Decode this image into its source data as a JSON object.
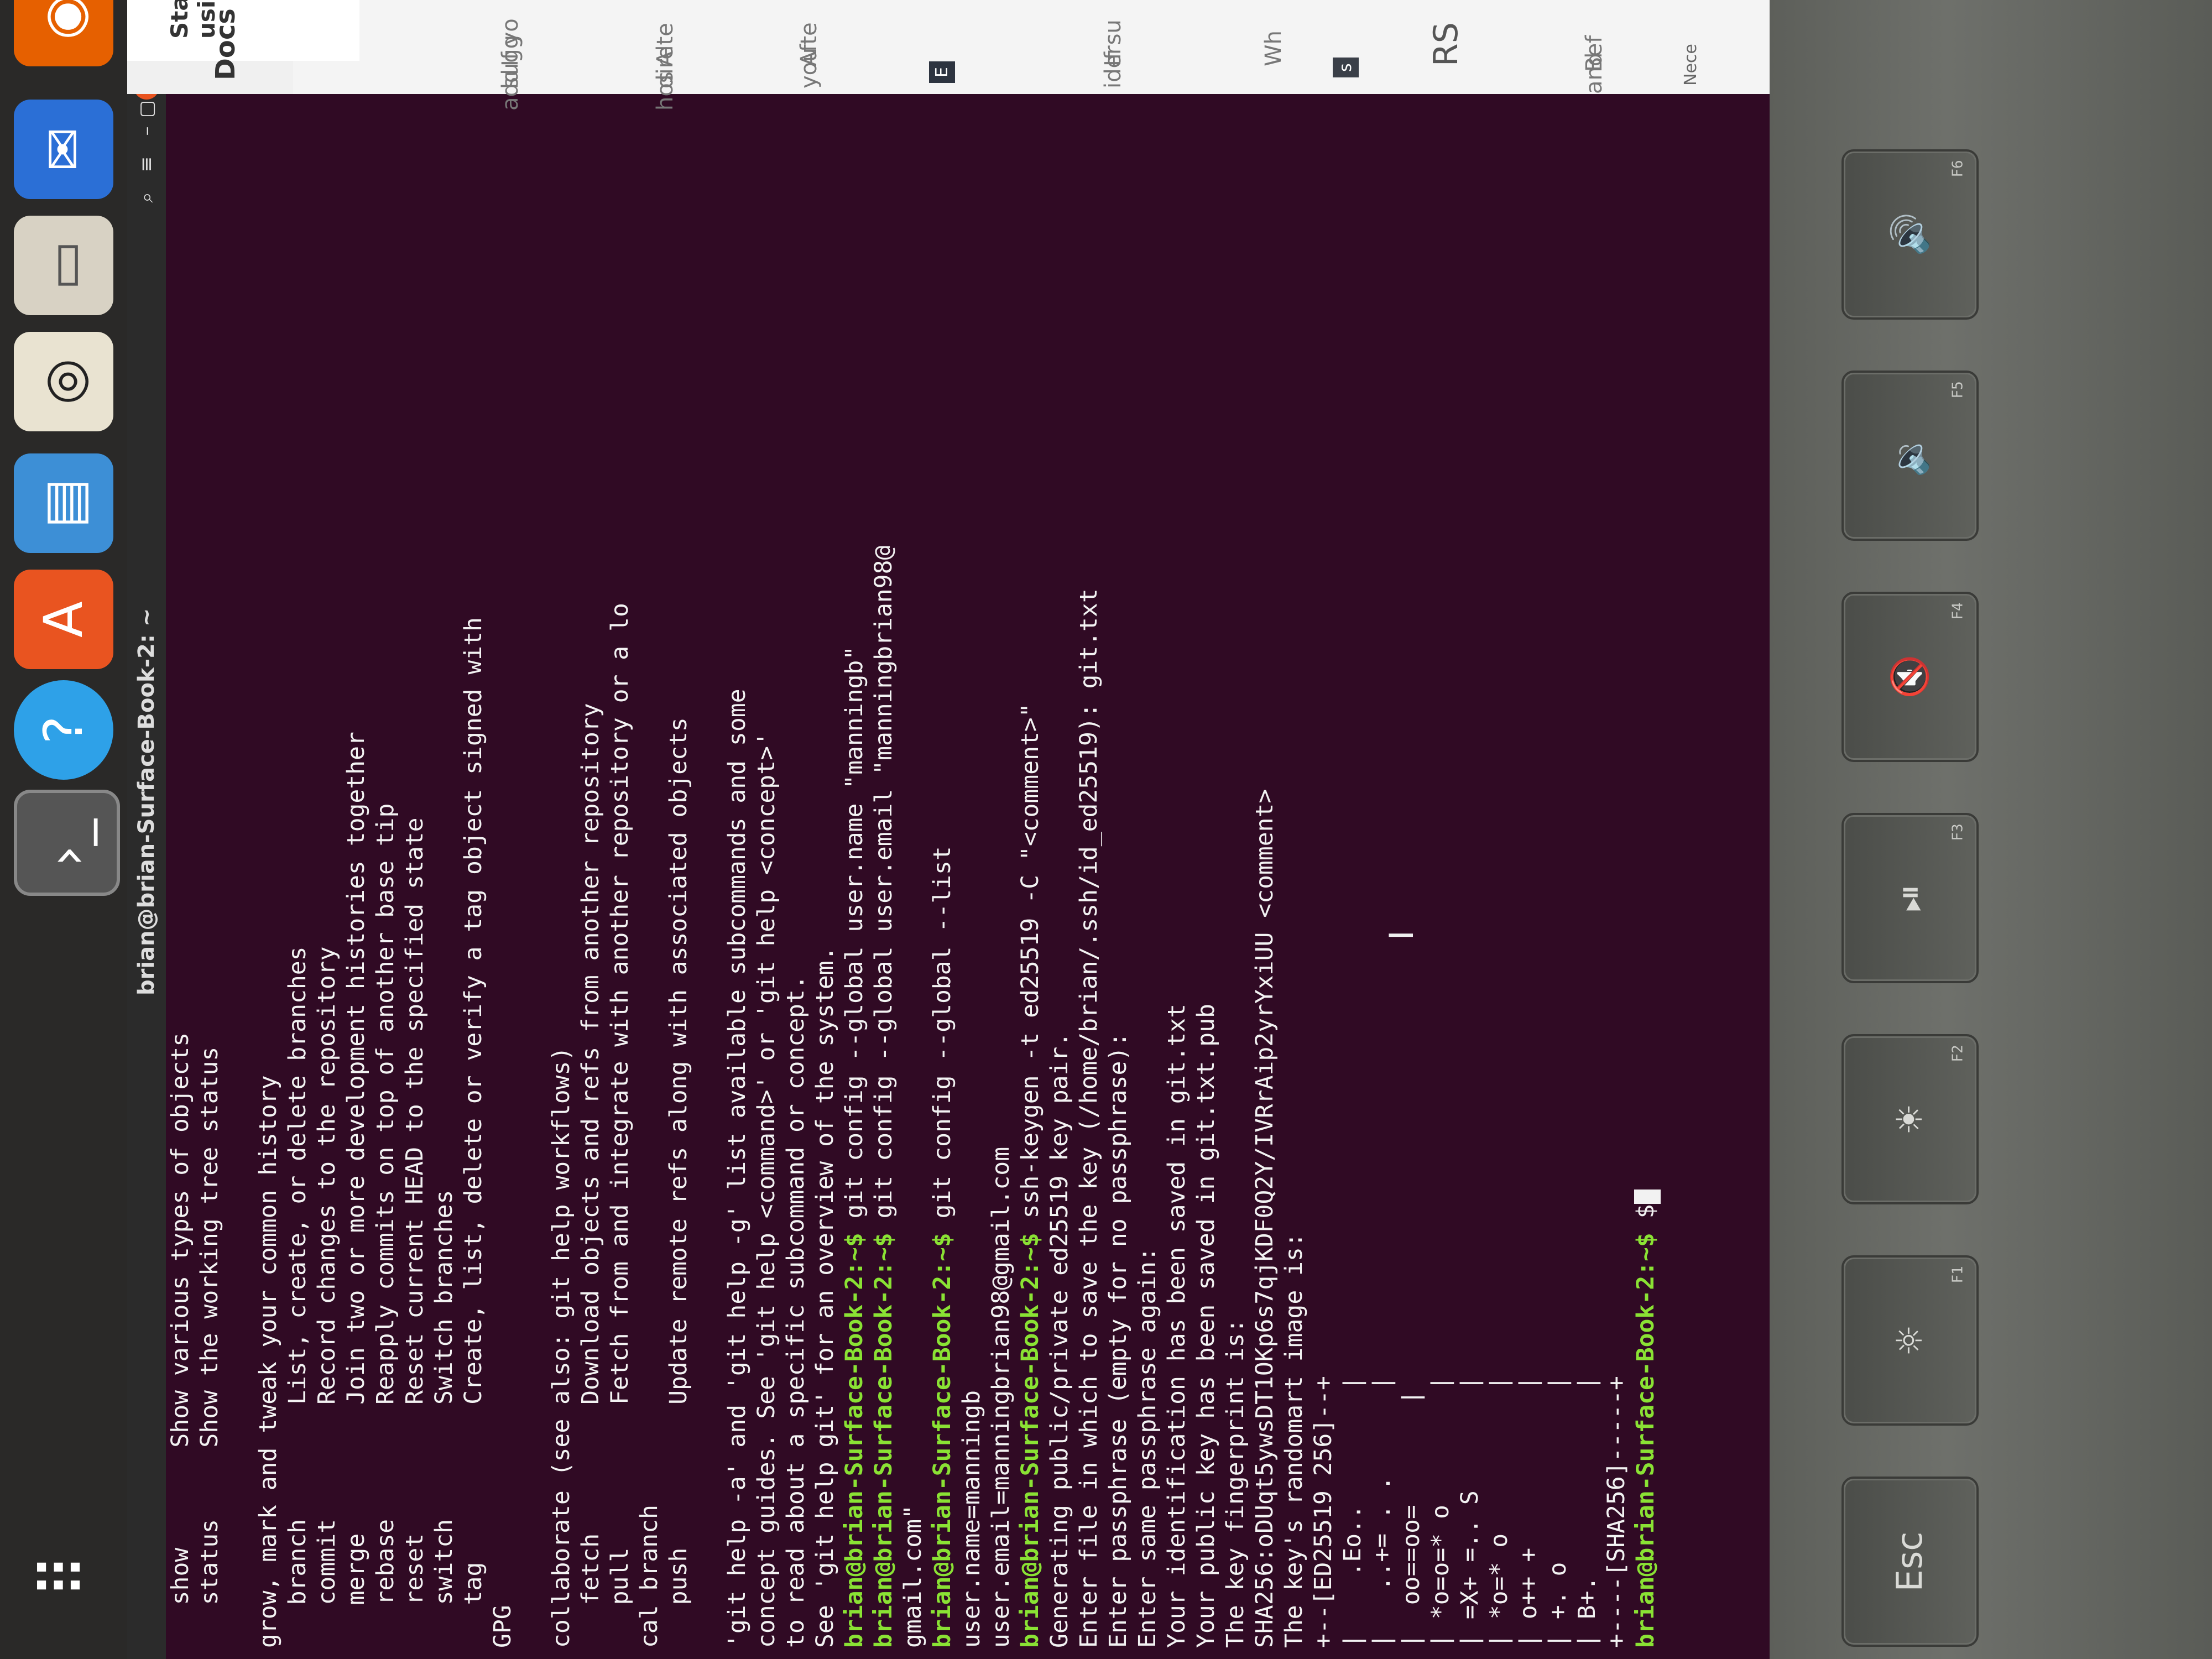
{
  "terminal": {
    "title": "brian@brian-Surface-Book-2: ~",
    "lines": [
      {
        "type": "text",
        "text": "   show       Show various types of objects"
      },
      {
        "type": "text",
        "text": "   status     Show the working tree status"
      },
      {
        "type": "text",
        "text": ""
      },
      {
        "type": "text",
        "text": "grow, mark and tweak your common history"
      },
      {
        "type": "text",
        "text": "   branch        List, create, or delete branches"
      },
      {
        "type": "text",
        "text": "   commit        Record changes to the repository"
      },
      {
        "type": "text",
        "text": "   merge         Join two or more development histories together"
      },
      {
        "type": "text",
        "text": "   rebase        Reapply commits on top of another base tip"
      },
      {
        "type": "text",
        "text": "   reset         Reset current HEAD to the specified state"
      },
      {
        "type": "text",
        "text": "   switch        Switch branches"
      },
      {
        "type": "text",
        "text": "   tag           Create, list, delete or verify a tag object signed with"
      },
      {
        "type": "text",
        "text": "GPG"
      },
      {
        "type": "text",
        "text": ""
      },
      {
        "type": "text",
        "text": "collaborate (see also: git help workflows)"
      },
      {
        "type": "text",
        "text": "   fetch         Download objects and refs from another repository"
      },
      {
        "type": "text",
        "text": "   pull          Fetch from and integrate with another repository or a lo"
      },
      {
        "type": "text",
        "text": "cal branch"
      },
      {
        "type": "text",
        "text": "   push          Update remote refs along with associated objects"
      },
      {
        "type": "text",
        "text": ""
      },
      {
        "type": "text",
        "text": "'git help -a' and 'git help -g' list available subcommands and some"
      },
      {
        "type": "text",
        "text": "concept guides. See 'git help <command>' or 'git help <concept>'"
      },
      {
        "type": "text",
        "text": "to read about a specific subcommand or concept."
      },
      {
        "type": "text",
        "text": "See 'git help git' for an overview of the system."
      },
      {
        "type": "prompt",
        "prompt": "brian@brian-Surface-Book-2:~$",
        "cmd": " git config --global user.name \"manningb\""
      },
      {
        "type": "prompt",
        "prompt": "brian@brian-Surface-Book-2:~$",
        "cmd": " git config --global user.email \"manningbrian98@"
      },
      {
        "type": "text",
        "text": "gmail.com\""
      },
      {
        "type": "prompt",
        "prompt": "brian@brian-Surface-Book-2:~$",
        "cmd": " git config --global --list"
      },
      {
        "type": "text",
        "text": "user.name=manningb"
      },
      {
        "type": "text",
        "text": "user.email=manningbrian98@gmail.com"
      },
      {
        "type": "prompt",
        "prompt": "brian@brian-Surface-Book-2:~$",
        "cmd": " ssh-keygen -t ed25519 -C \"<comment>\""
      },
      {
        "type": "text",
        "text": "Generating public/private ed25519 key pair."
      },
      {
        "type": "text",
        "text": "Enter file in which to save the key (/home/brian/.ssh/id_ed25519): git.txt"
      },
      {
        "type": "text",
        "text": "Enter passphrase (empty for no passphrase):"
      },
      {
        "type": "text",
        "text": "Enter same passphrase again:"
      },
      {
        "type": "text",
        "text": "Your identification has been saved in git.txt"
      },
      {
        "type": "text",
        "text": "Your public key has been saved in git.txt.pub"
      },
      {
        "type": "text",
        "text": "The key fingerprint is:"
      },
      {
        "type": "text",
        "text": "SHA256:oDUqt5ywsDT1OKp6s7qjKDF0Q2Y/IVRrAip2yrYxiUU <comment>"
      },
      {
        "type": "text",
        "text": "The key's randomart image is:"
      },
      {
        "type": "text",
        "text": "+--[ED25519 256]--+"
      },
      {
        "type": "text",
        "text": "|    .Eo..        |"
      },
      {
        "type": "text",
        "text": "|   ..+= . .      |"
      },
      {
        "type": "text",
        "text": "|  oo==oo=       |"
      },
      {
        "type": "text",
        "text": "| *o=o=* o        |"
      },
      {
        "type": "text",
        "text": "| =X+ =.. S       |"
      },
      {
        "type": "text",
        "text": "| *o=* o          |"
      },
      {
        "type": "text",
        "text": "| o++ +           |"
      },
      {
        "type": "text",
        "text": "| +. o            |"
      },
      {
        "type": "text",
        "text": "| B+.             |"
      },
      {
        "type": "text",
        "text": "+----[SHA256]-----+"
      },
      {
        "type": "prompt_cursor",
        "prompt": "brian@brian-Surface-Book-2:~$",
        "cmd": " $"
      }
    ]
  },
  "browser": {
    "tab_label": "Start using",
    "docs_label": "Docs",
    "side_texts": [
      "If yo",
      "sugg",
      "add",
      "Alte",
      "dire",
      "hos",
      "Afte",
      "you",
      "If su",
      "ider",
      "Wh",
      "RS",
      "Bef",
      "and"
    ],
    "box_labels": [
      "E",
      "s"
    ],
    "footer_label": "Nece"
  },
  "keyboard": {
    "keys": [
      {
        "label": "Esc",
        "fn": ""
      },
      {
        "label": "☼",
        "fn": "F1"
      },
      {
        "label": "☀",
        "fn": "F2"
      },
      {
        "label": "⏯",
        "fn": "F3"
      },
      {
        "label": "🔇",
        "fn": "F4"
      },
      {
        "label": "🔉",
        "fn": "F5"
      },
      {
        "label": "🔊",
        "fn": "F6"
      }
    ]
  },
  "dock": {
    "icons": [
      "firefox-icon",
      "thunderbird-icon",
      "files-icon",
      "rhythmbox-icon",
      "writer-icon",
      "software-icon",
      "help-icon",
      "terminal-icon",
      "apps-grid-icon"
    ]
  }
}
